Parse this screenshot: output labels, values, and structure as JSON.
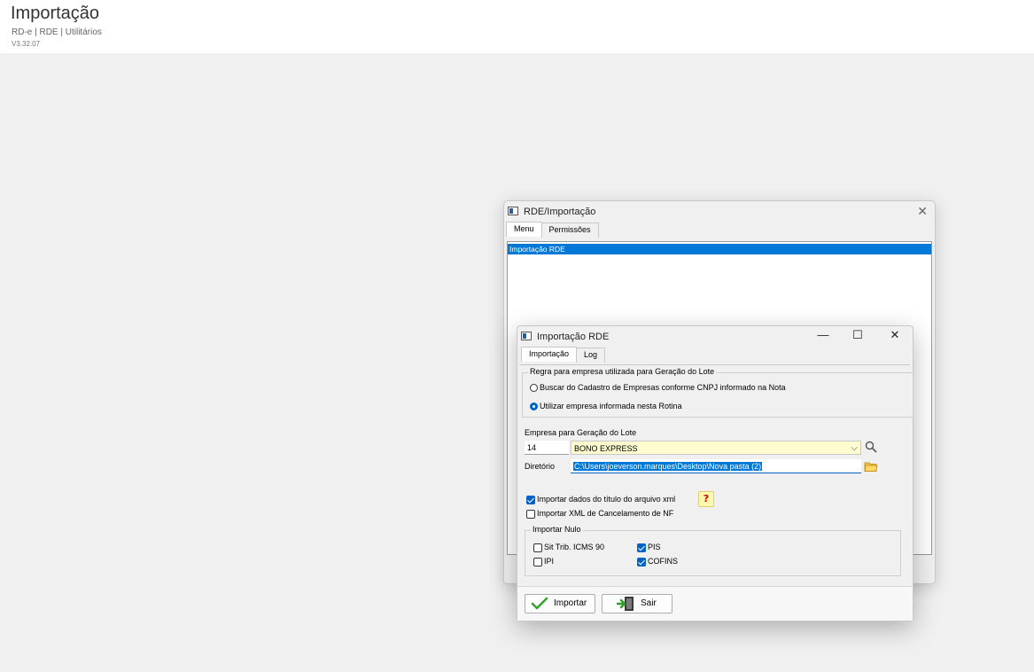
{
  "page": {
    "title": "Importação",
    "breadcrumb": "RD-e | RDE | Utilitários",
    "version": "V3.32.07"
  },
  "back_window": {
    "title": "RDE/Importação",
    "close_label": "✕",
    "tabs": [
      {
        "label": "Menu"
      },
      {
        "label": "Permissões"
      }
    ],
    "list_items": [
      {
        "label": "Importação RDE"
      }
    ]
  },
  "front_window": {
    "title": "Importação RDE",
    "minimize_label": "—",
    "maximize_label": "☐",
    "close_label": "✕",
    "tabs": [
      {
        "label": "Importação"
      },
      {
        "label": "Log"
      }
    ],
    "rule_group": {
      "legend": "Regra para empresa utilizada para Geração do Lote",
      "option_cadastro": "Buscar do Cadastro de Empresas conforme CNPJ informado na Nota",
      "option_rotina": "Utilizar empresa informada nesta Rotina"
    },
    "empresa": {
      "label": "Empresa para Geração do Lote",
      "code": "14",
      "name": "BONO EXPRESS"
    },
    "diretorio": {
      "label": "Diretório",
      "value": "C:\\Users\\joeverson.marques\\Desktop\\Nova pasta (2)"
    },
    "checks": {
      "importar_titulo": "Importar dados do título do arquivo xml",
      "help_glyph": "?",
      "importar_cancelamento": "Importar XML de Cancelamento de NF"
    },
    "importar_nulo": {
      "legend": "Importar Nulo",
      "sit_trib": "Sit Trib. ICMS 90",
      "ipi": "IPI",
      "pis": "PIS",
      "cofins": "COFINS"
    },
    "buttons": {
      "importar": "Importar",
      "sair": "Sair"
    }
  },
  "colors": {
    "accent": "#0078d7",
    "check": "#0062c4",
    "highlight_field": "#fffdd0"
  },
  "icons": [
    "app-icon",
    "search-icon",
    "folder-icon",
    "checkmark-icon",
    "exit-door-icon",
    "help-icon"
  ]
}
